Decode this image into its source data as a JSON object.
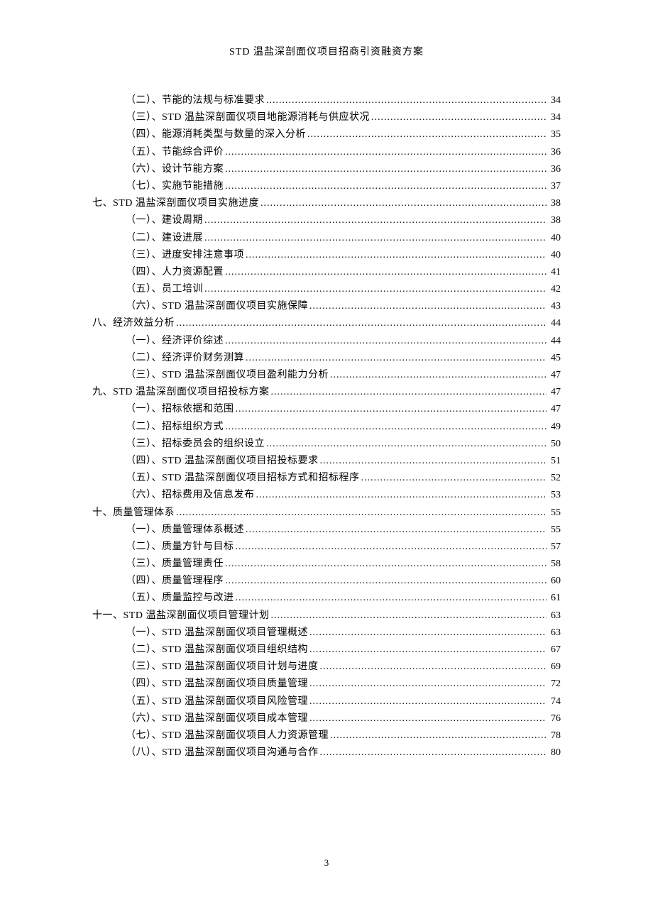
{
  "header": "STD 温盐深剖面仪项目招商引资融资方案",
  "page_number": "3",
  "toc": [
    {
      "level": 2,
      "label": "（二）、节能的法规与标准要求",
      "page": "34"
    },
    {
      "level": 2,
      "label": "（三）、STD 温盐深剖面仪项目地能源消耗与供应状况",
      "page": "34"
    },
    {
      "level": 2,
      "label": "（四）、能源消耗类型与数量的深入分析",
      "page": "35"
    },
    {
      "level": 2,
      "label": "（五）、节能综合评价",
      "page": "36"
    },
    {
      "level": 2,
      "label": "（六）、设计节能方案",
      "page": "36"
    },
    {
      "level": 2,
      "label": "（七）、实施节能措施",
      "page": "37"
    },
    {
      "level": 1,
      "label": "七、STD 温盐深剖面仪项目实施进度",
      "page": "38"
    },
    {
      "level": 2,
      "label": "（一）、建设周期",
      "page": "38"
    },
    {
      "level": 2,
      "label": "（二）、建设进展",
      "page": "40"
    },
    {
      "level": 2,
      "label": "（三）、进度安排注意事项",
      "page": "40"
    },
    {
      "level": 2,
      "label": "（四）、人力资源配置",
      "page": "41"
    },
    {
      "level": 2,
      "label": "（五）、员工培训",
      "page": "42"
    },
    {
      "level": 2,
      "label": "（六）、STD 温盐深剖面仪项目实施保障",
      "page": "43"
    },
    {
      "level": 1,
      "label": "八、经济效益分析",
      "page": "44"
    },
    {
      "level": 2,
      "label": "（一）、经济评价综述",
      "page": "44"
    },
    {
      "level": 2,
      "label": "（二）、经济评价财务测算",
      "page": "45"
    },
    {
      "level": 2,
      "label": "（三）、STD 温盐深剖面仪项目盈利能力分析",
      "page": "47"
    },
    {
      "level": 1,
      "label": "九、STD 温盐深剖面仪项目招投标方案",
      "page": "47"
    },
    {
      "level": 2,
      "label": "（一）、招标依据和范围",
      "page": "47"
    },
    {
      "level": 2,
      "label": "（二）、招标组织方式",
      "page": "49"
    },
    {
      "level": 2,
      "label": "（三）、招标委员会的组织设立",
      "page": "50"
    },
    {
      "level": 2,
      "label": "（四）、STD 温盐深剖面仪项目招投标要求",
      "page": "51"
    },
    {
      "level": 2,
      "label": "（五）、STD 温盐深剖面仪项目招标方式和招标程序",
      "page": "52"
    },
    {
      "level": 2,
      "label": "（六）、招标费用及信息发布",
      "page": "53"
    },
    {
      "level": 1,
      "label": "十、质量管理体系",
      "page": "55"
    },
    {
      "level": 2,
      "label": "（一）、质量管理体系概述",
      "page": "55"
    },
    {
      "level": 2,
      "label": "（二）、质量方针与目标",
      "page": "57"
    },
    {
      "level": 2,
      "label": "（三）、质量管理责任",
      "page": "58"
    },
    {
      "level": 2,
      "label": "（四）、质量管理程序",
      "page": "60"
    },
    {
      "level": 2,
      "label": "（五）、质量监控与改进",
      "page": "61"
    },
    {
      "level": 1,
      "label": "十一、STD 温盐深剖面仪项目管理计划",
      "page": "63"
    },
    {
      "level": 2,
      "label": "（一）、STD 温盐深剖面仪项目管理概述",
      "page": "63"
    },
    {
      "level": 2,
      "label": "（二）、STD 温盐深剖面仪项目组织结构",
      "page": "67"
    },
    {
      "level": 2,
      "label": "（三）、STD 温盐深剖面仪项目计划与进度",
      "page": "69"
    },
    {
      "level": 2,
      "label": "（四）、STD 温盐深剖面仪项目质量管理",
      "page": "72"
    },
    {
      "level": 2,
      "label": "（五）、STD 温盐深剖面仪项目风险管理",
      "page": "74"
    },
    {
      "level": 2,
      "label": "（六）、STD 温盐深剖面仪项目成本管理",
      "page": "76"
    },
    {
      "level": 2,
      "label": "（七）、STD 温盐深剖面仪项目人力资源管理",
      "page": "78"
    },
    {
      "level": 2,
      "label": "（八）、STD 温盐深剖面仪项目沟通与合作",
      "page": "80"
    }
  ]
}
